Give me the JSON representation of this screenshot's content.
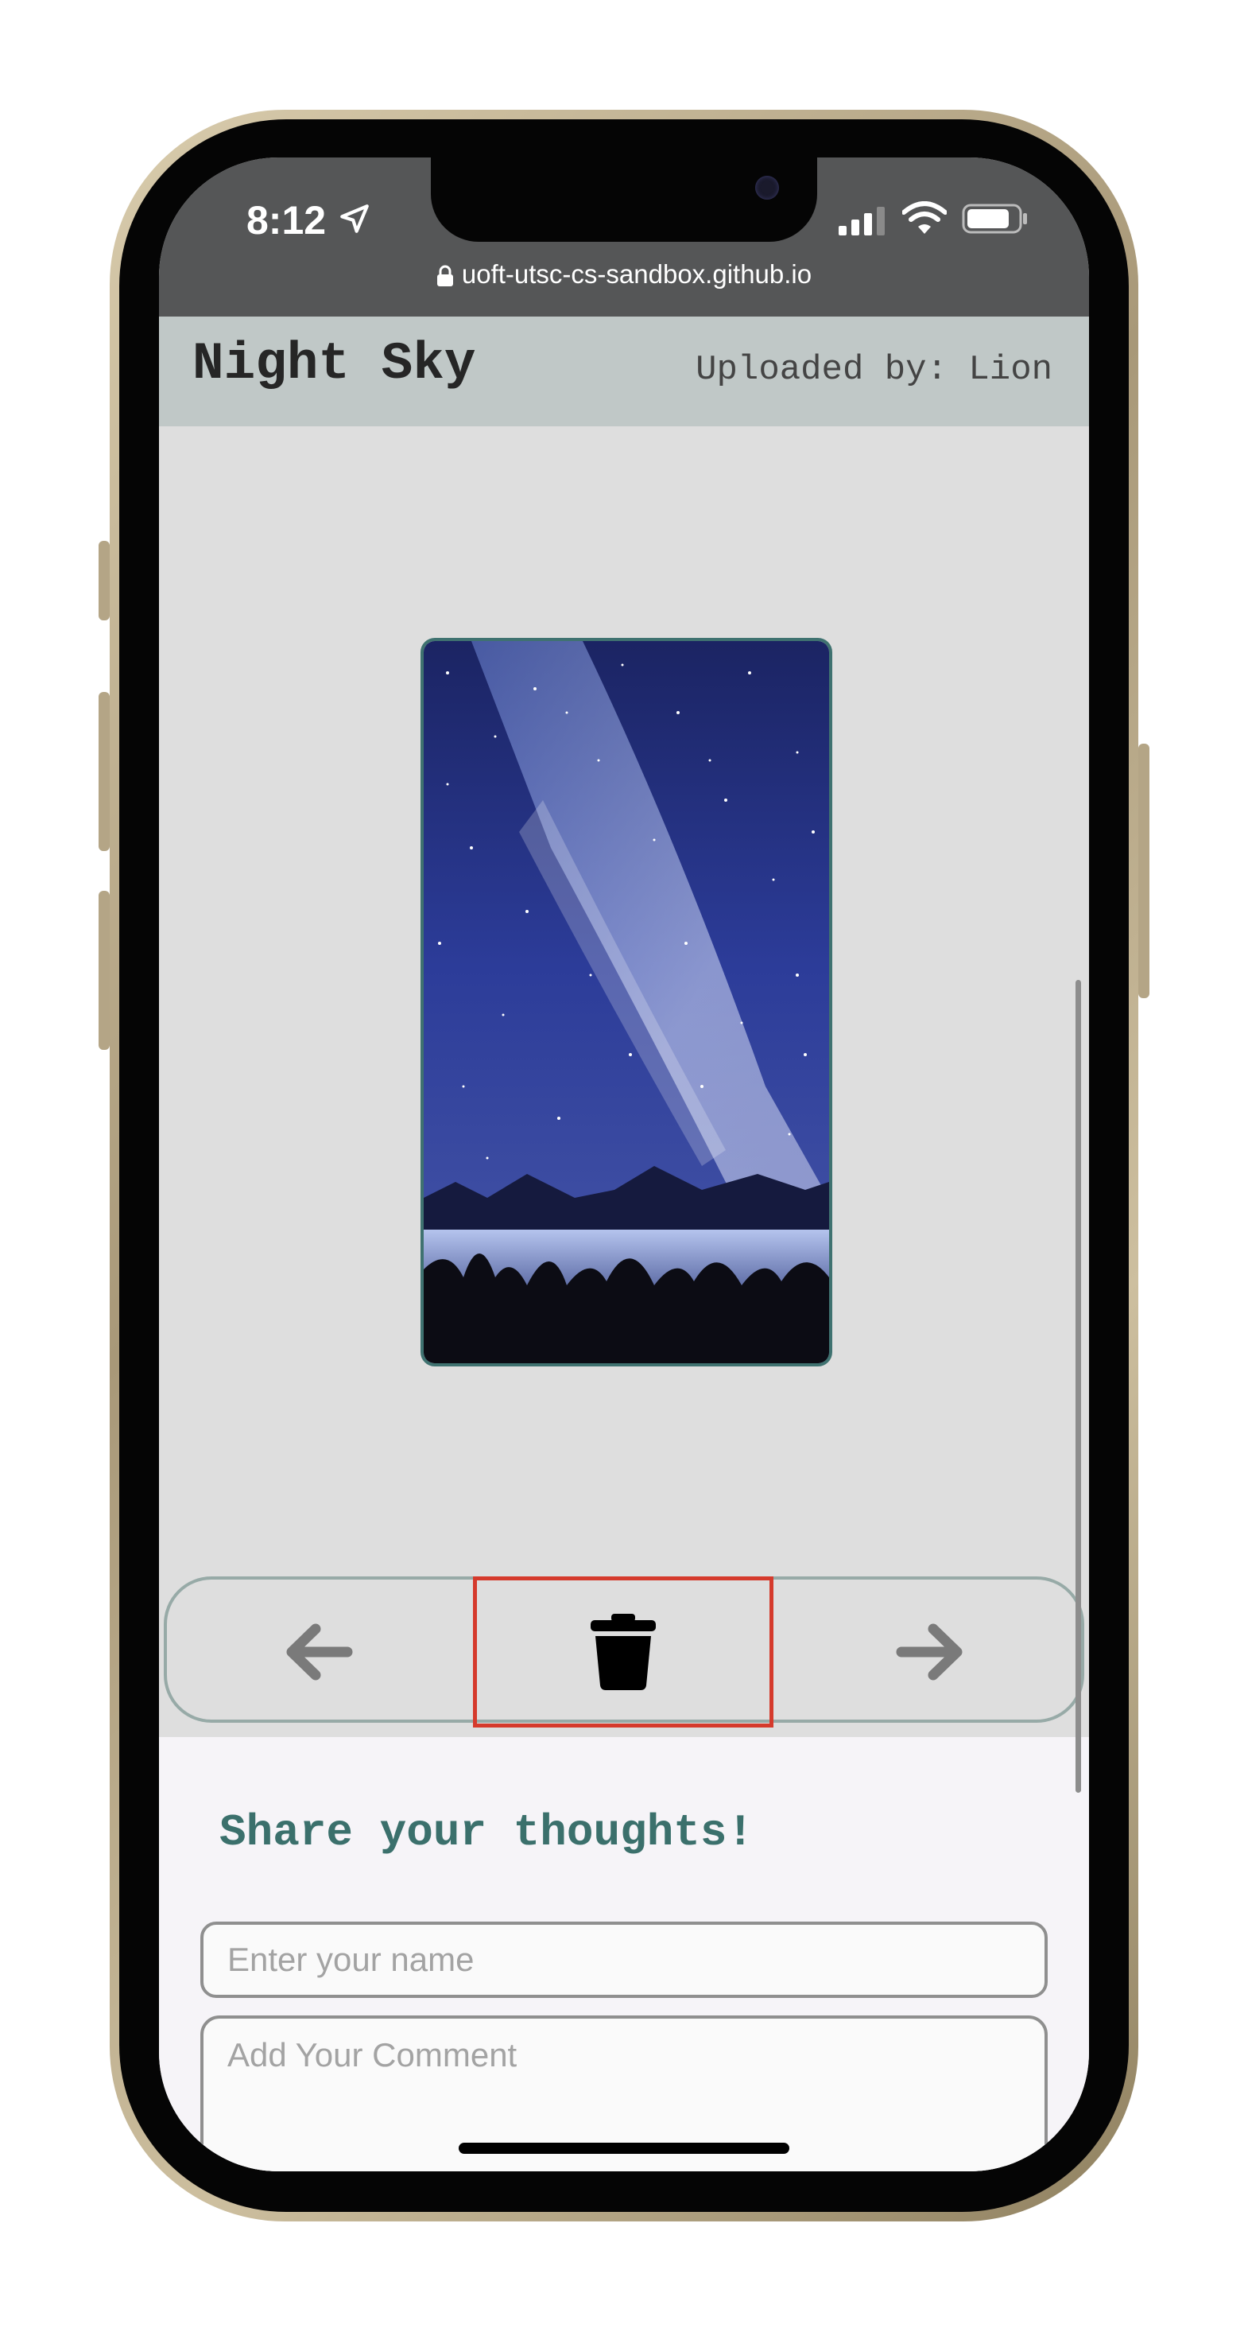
{
  "status_bar": {
    "time": "8:12",
    "url": "uoft-utsc-cs-sandbox.github.io"
  },
  "header": {
    "title": "Night Sky",
    "uploader": "Uploaded by: Lion"
  },
  "photo": {
    "subject": "night-sky-milky-way"
  },
  "navigation": {
    "prev_icon": "arrow-left-icon",
    "delete_icon": "trash-icon",
    "next_icon": "arrow-right-icon",
    "highlight_color": "#d53a2c"
  },
  "comments": {
    "title": "Share your thoughts!",
    "name_placeholder": "Enter your name",
    "comment_placeholder": "Add Your Comment"
  },
  "colors": {
    "header_bg": "#c0c8c7",
    "accent_teal": "#3b706c",
    "page_bg": "#dedede"
  }
}
